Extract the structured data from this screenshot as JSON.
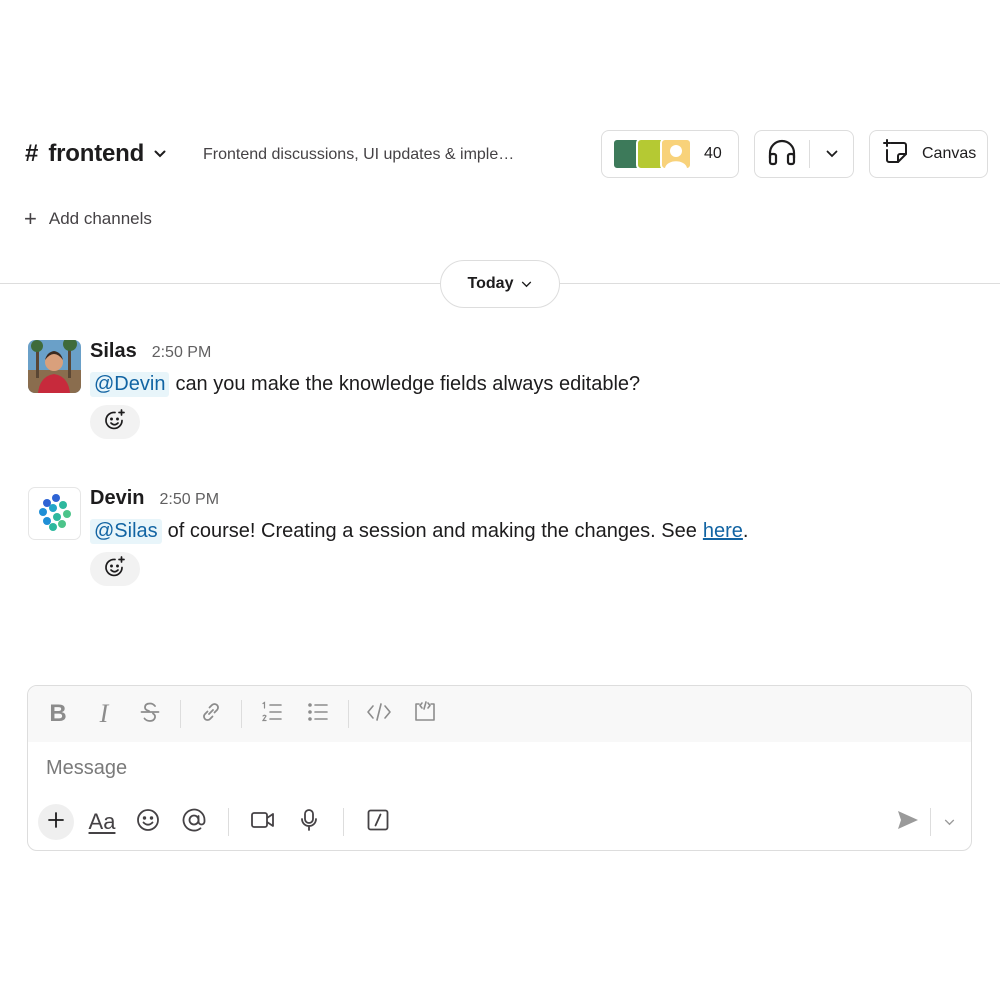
{
  "header": {
    "hash": "#",
    "channel_name": "frontend",
    "topic": "Frontend discussions, UI updates & imple…",
    "member_count": "40",
    "canvas_label": "Canvas",
    "member_avatar_colors": [
      "#3d7a5a",
      "#b5c933",
      "#f8d27a"
    ]
  },
  "bookmarks": {
    "add_channels_plus": "+",
    "add_channels_label": "Add channels"
  },
  "divider": {
    "label": "Today"
  },
  "messages": [
    {
      "author": "Silas",
      "time": "2:50 PM",
      "mention": "@Devin",
      "text": "can you make the knowledge fields always editable?"
    },
    {
      "author": "Devin",
      "time": "2:50 PM",
      "mention": "@Silas",
      "text": "of course! Creating a session and making the changes. See",
      "link_text": "here",
      "trailing": "."
    }
  ],
  "composer": {
    "placeholder": "Message",
    "format_tools": [
      "bold-icon",
      "italic-icon",
      "strikethrough-icon",
      "link-icon",
      "ordered-list-icon",
      "bullet-list-icon",
      "code-icon",
      "code-block-icon"
    ],
    "action_tools": [
      "plus-icon",
      "text-format-icon",
      "emoji-icon",
      "mention-icon",
      "video-icon",
      "microphone-icon",
      "slash-command-icon"
    ],
    "text_format_label": "Aa"
  },
  "colors": {
    "link": "#1264a3",
    "mention_bg": "#e8f5fa",
    "border": "#dddddd"
  }
}
